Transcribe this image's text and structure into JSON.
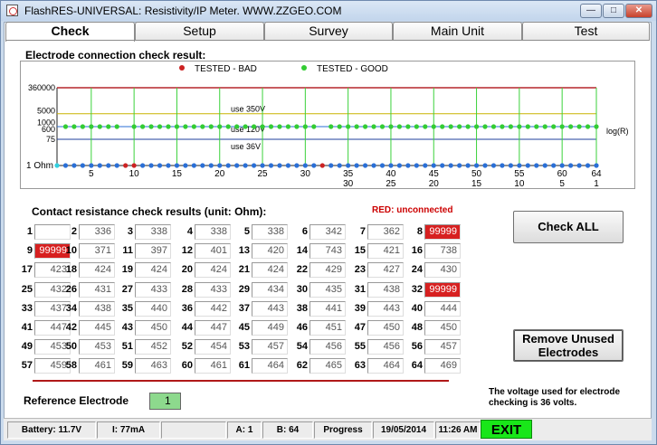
{
  "window": {
    "title": "FlashRES-UNIVERSAL: Resistivity/IP Meter.  WWW.ZZGEO.COM"
  },
  "window_buttons": {
    "minimize": "—",
    "maximize": "□",
    "close": "✕"
  },
  "tabs": [
    {
      "label": "Check"
    },
    {
      "label": "Setup"
    },
    {
      "label": "Survey"
    },
    {
      "label": "Main Unit"
    },
    {
      "label": "Test"
    }
  ],
  "chart_title": "Electrode connection check result:",
  "chart_data": {
    "type": "scatter",
    "legend": [
      {
        "label": "TESTED - BAD",
        "color": "#cc2222"
      },
      {
        "label": "TESTED - GOOD",
        "color": "#33cc33"
      }
    ],
    "y_tick_labels": [
      "360000",
      "5000",
      "1000",
      "600",
      "75",
      "1 Ohm"
    ],
    "y_axis_label": "log(R)",
    "x_ticks_top": [
      "5",
      "10",
      "15",
      "20",
      "25",
      "30",
      "35",
      "40",
      "45",
      "50",
      "55",
      "60",
      "64"
    ],
    "x_ticks_bottom": [
      "",
      "",
      "",
      "",
      "",
      "",
      "30",
      "25",
      "20",
      "15",
      "10",
      "5",
      "1"
    ],
    "voltage_lines": [
      {
        "label": "use 350V",
        "value": 5000
      },
      {
        "label": "use 120V",
        "value": 600
      },
      {
        "label": "use 36V",
        "value": 75
      }
    ],
    "good_resistance_ohm": 600,
    "bad_top_electrodes": [
      1,
      9,
      32
    ],
    "connection_dots": {
      "electrodes": 64,
      "colors": {
        "1": "#33d0e0",
        "9": "#cc2222",
        "10": "#cc2222",
        "32": "#cc2222",
        "default": "#2a6fd6"
      }
    }
  },
  "contact": {
    "title": "Contact resistance check results (unit: Ohm):",
    "red_note": "RED: unconnected",
    "values": [
      "",
      "336",
      "338",
      "338",
      "338",
      "342",
      "362",
      "99999",
      "99999",
      "371",
      "397",
      "401",
      "420",
      "743",
      "421",
      "738",
      "423",
      "424",
      "424",
      "424",
      "424",
      "429",
      "427",
      "430",
      "432",
      "431",
      "433",
      "433",
      "434",
      "435",
      "438",
      "99999",
      "437",
      "438",
      "440",
      "442",
      "443",
      "441",
      "443",
      "444",
      "447",
      "445",
      "450",
      "447",
      "449",
      "451",
      "450",
      "450",
      "453",
      "453",
      "452",
      "454",
      "457",
      "456",
      "456",
      "457",
      "459",
      "461",
      "463",
      "461",
      "464",
      "465",
      "464",
      "469"
    ]
  },
  "buttons": {
    "check_all": "Check ALL",
    "remove_line1": "Remove Unused",
    "remove_line2": "Electrodes"
  },
  "reference": {
    "label": "Reference  Electrode",
    "value": "1"
  },
  "voltage_note": "The voltage used for electrode checking is 36 volts.",
  "status": {
    "battery": "Battery: 11.7V",
    "current": "I:  77mA",
    "a": "A: 1",
    "b": "B: 64",
    "progress": "Progress",
    "date": "19/05/2014",
    "time": "11:26 AM",
    "exit": "EXIT"
  }
}
